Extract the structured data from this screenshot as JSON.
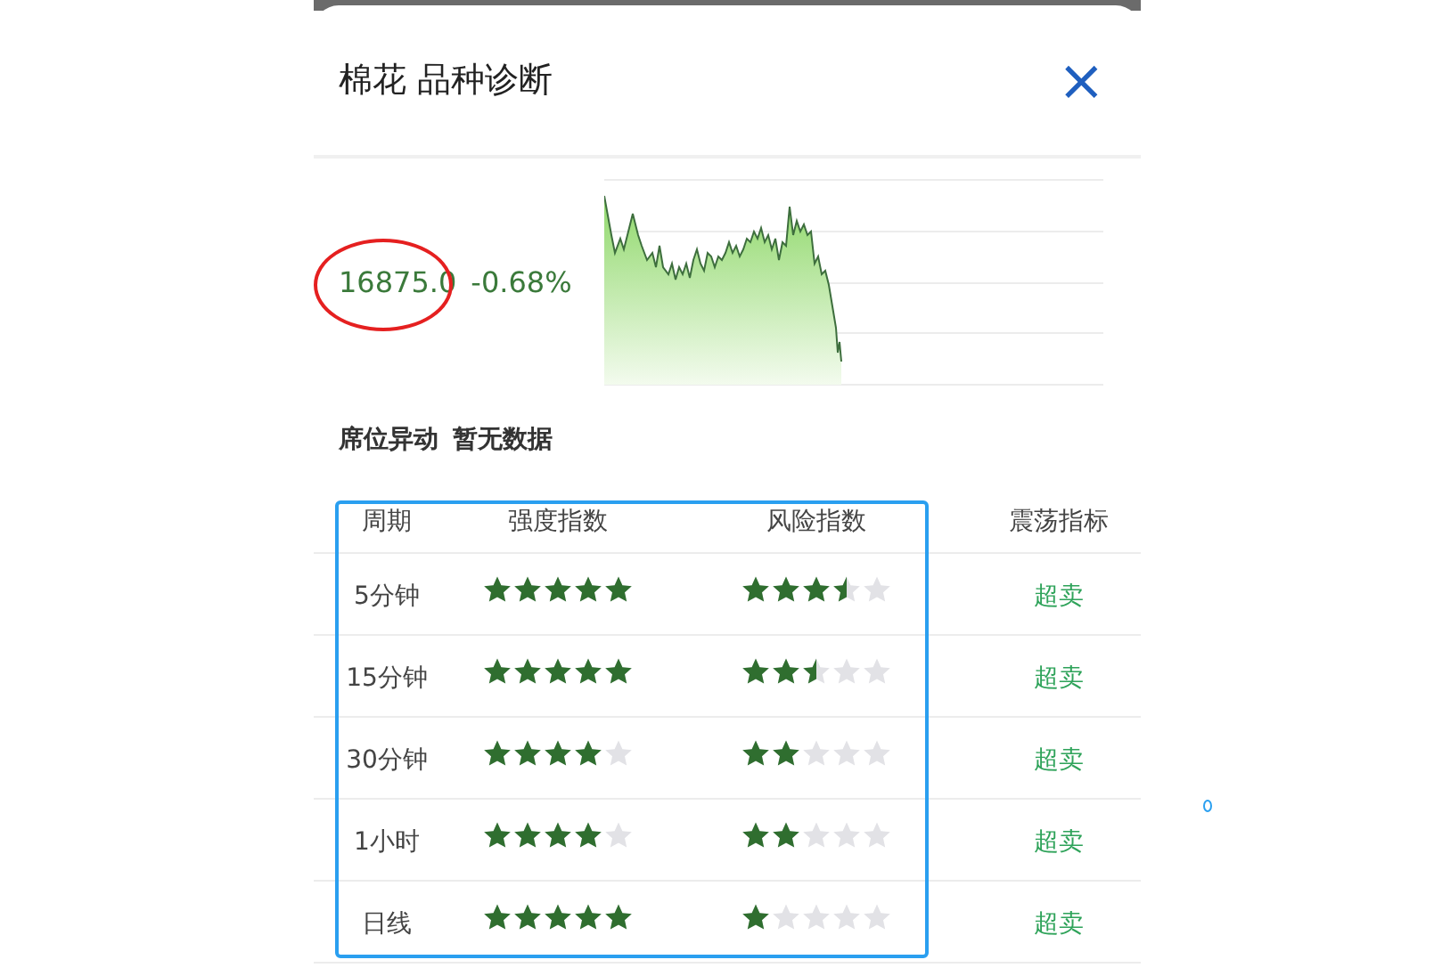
{
  "sheet": {
    "title": "棉花 品种诊断",
    "close": "×"
  },
  "quote": {
    "price": "16875.0",
    "change": "-0.68%"
  },
  "seat": {
    "label": "席位异动",
    "value": "暂无数据"
  },
  "table": {
    "columns": [
      "周期",
      "强度指数",
      "风险指数",
      "震荡指标"
    ],
    "rows": [
      {
        "period": "5分钟",
        "strength": {
          "stars": 5
        },
        "risk": {
          "stars": 3.5
        },
        "oscillation": "超卖"
      },
      {
        "period": "15分钟",
        "strength": {
          "stars": 5
        },
        "risk": {
          "stars": 2.5
        },
        "oscillation": "超卖"
      },
      {
        "period": "30分钟",
        "strength": {
          "stars": 4
        },
        "risk": {
          "stars": 2
        },
        "oscillation": "超卖"
      },
      {
        "period": "1小时",
        "strength": {
          "stars": 4
        },
        "risk": {
          "stars": 2
        },
        "oscillation": "超卖"
      },
      {
        "period": "日线",
        "strength": {
          "stars": 5
        },
        "risk": {
          "stars": 1
        },
        "oscillation": "超卖"
      }
    ]
  }
}
